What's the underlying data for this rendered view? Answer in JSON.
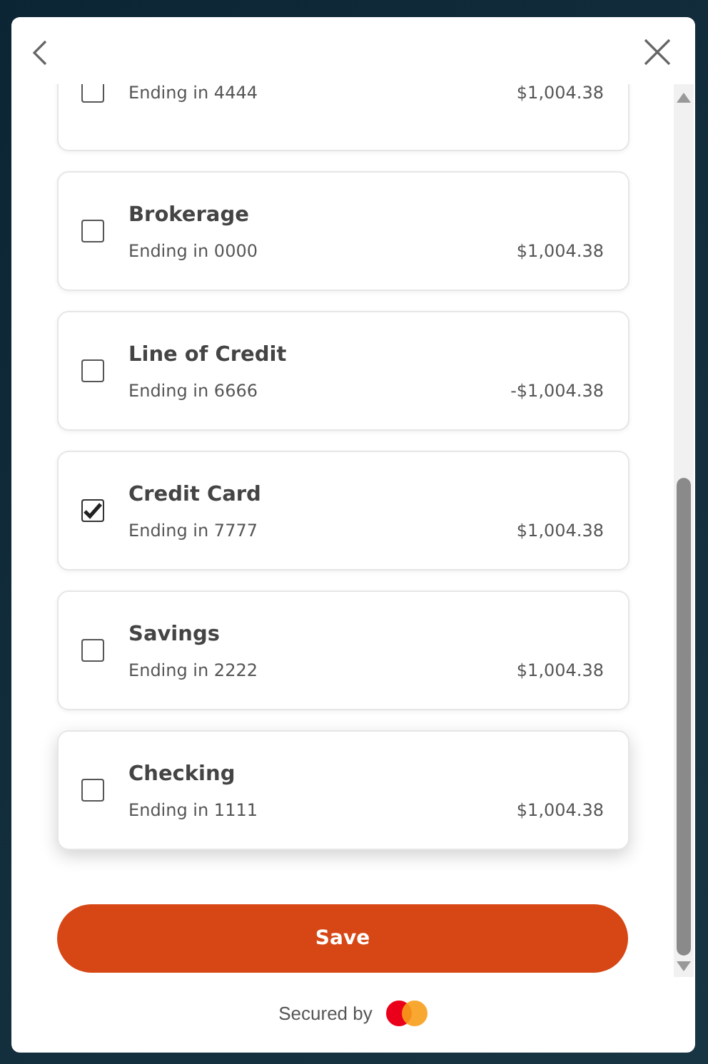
{
  "accounts": [
    {
      "detail": "Ending in 4444",
      "amount": "$1,004.38",
      "checked": false
    },
    {
      "name": "Brokerage",
      "detail": "Ending in 0000",
      "amount": "$1,004.38",
      "checked": false
    },
    {
      "name": "Line of Credit",
      "detail": "Ending in 6666",
      "amount": "-$1,004.38",
      "checked": false
    },
    {
      "name": "Credit Card",
      "detail": "Ending in 7777",
      "amount": "$1,004.38",
      "checked": true
    },
    {
      "name": "Savings",
      "detail": "Ending in 2222",
      "amount": "$1,004.38",
      "checked": false
    },
    {
      "name": "Checking",
      "detail": "Ending in 1111",
      "amount": "$1,004.38",
      "checked": false
    }
  ],
  "save_button": "Save",
  "footer": {
    "text": "Secured by"
  }
}
